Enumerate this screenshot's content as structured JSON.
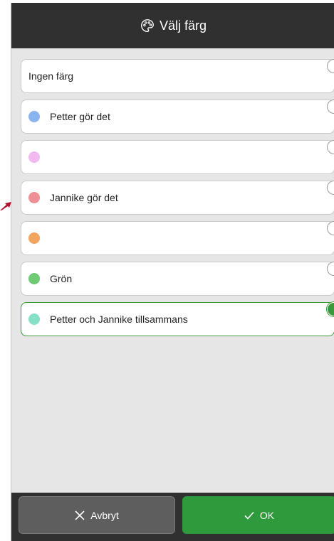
{
  "header": {
    "title": "Välj färg",
    "icon": "palette-icon"
  },
  "options": [
    {
      "label": "Ingen färg",
      "color": "",
      "selected": false
    },
    {
      "label": "Petter gör det",
      "color": "#8ab4f0",
      "selected": false
    },
    {
      "label": "",
      "color": "#f2b8f0",
      "selected": false
    },
    {
      "label": "Jannike gör det",
      "color": "#ee8f96",
      "selected": false
    },
    {
      "label": "",
      "color": "#f2a55e",
      "selected": false
    },
    {
      "label": "Grön",
      "color": "#6ecb73",
      "selected": false
    },
    {
      "label": "Petter och Jannike tillsammans",
      "color": "#86e0c8",
      "selected": true
    }
  ],
  "footer": {
    "cancel_label": "Avbryt",
    "ok_label": "OK"
  },
  "colors": {
    "accent_green": "#2f9a3c",
    "header_bg": "#303030",
    "arrow": "#b0112f"
  }
}
